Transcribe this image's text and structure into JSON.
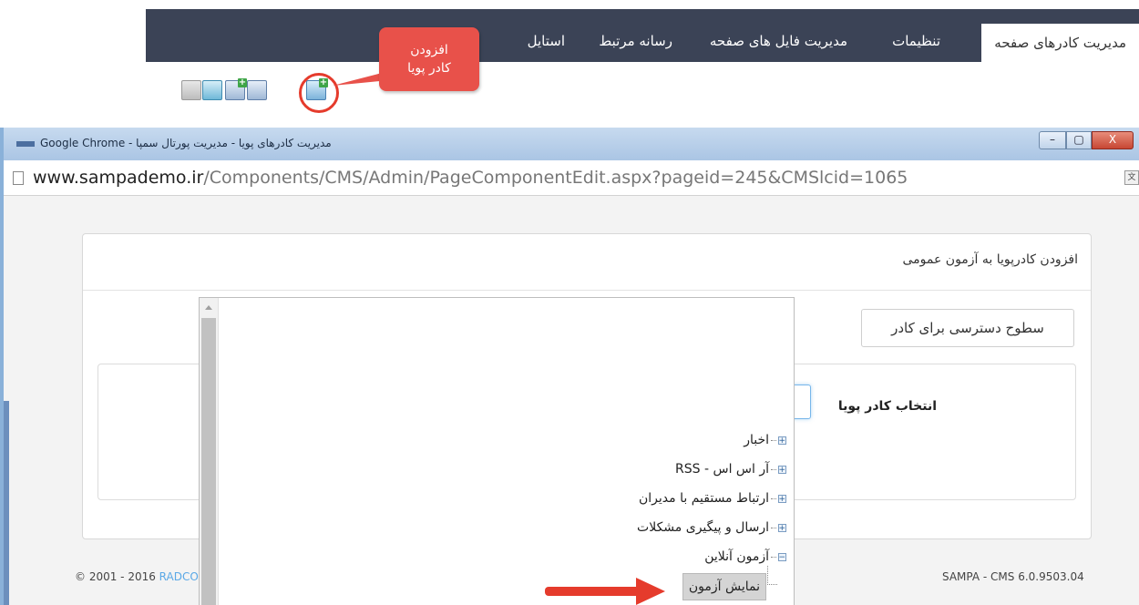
{
  "admin_tabs": [
    {
      "label": "مدیریت کادرهای صفحه",
      "active": true
    },
    {
      "label": "تنظیمات"
    },
    {
      "label": "مدیریت فایل های صفحه"
    },
    {
      "label": "رسانه مرتبط"
    },
    {
      "label": "استایل"
    }
  ],
  "toolbar": {
    "icons": [
      "paste-icon",
      "refresh-icon",
      "add-component-icon",
      "preview-icon",
      "add-dynamic-component-icon"
    ]
  },
  "callout": {
    "line1": "افزودن",
    "line2": "کادر پویا",
    "color": "#e8514a"
  },
  "window": {
    "title": "مدیریت کادرهای پویا - مدیریت پورتال سمپا - Google Chrome",
    "url_host": "www.sampademo.ir",
    "url_path": "/Components/CMS/Admin/PageComponentEdit.aspx?pageid=245&CMSlcid=1065",
    "min_label": "–",
    "max_label": "▢",
    "close_label": "X"
  },
  "panel": {
    "title": "افزودن کادرپویا به آزمون عمومی",
    "access_button": "سطوح دسترسی برای کادر",
    "select_label": "انتخاب کادر پویا"
  },
  "tree": {
    "items": [
      {
        "label": "اخبار",
        "toggle": "+"
      },
      {
        "label": "آر اس اس - RSS",
        "toggle": "+"
      },
      {
        "label": "ارتباط مستقیم با مدیران",
        "toggle": "+"
      },
      {
        "label": "ارسال و پیگیری مشکلات",
        "toggle": "+"
      },
      {
        "label": "آزمون آنلاین",
        "toggle": "−"
      }
    ],
    "child": "نمایش آزمون"
  },
  "footer": {
    "copyright_prefix": "© 2001 - 2016 ",
    "copyright_brand": "RADCO",
    "version": "SAMPA - CMS 6.0.9503.04"
  },
  "colors": {
    "topbar": "#3b4356",
    "highlight": "#e53b2c",
    "titlebar": "#aac5e4"
  }
}
